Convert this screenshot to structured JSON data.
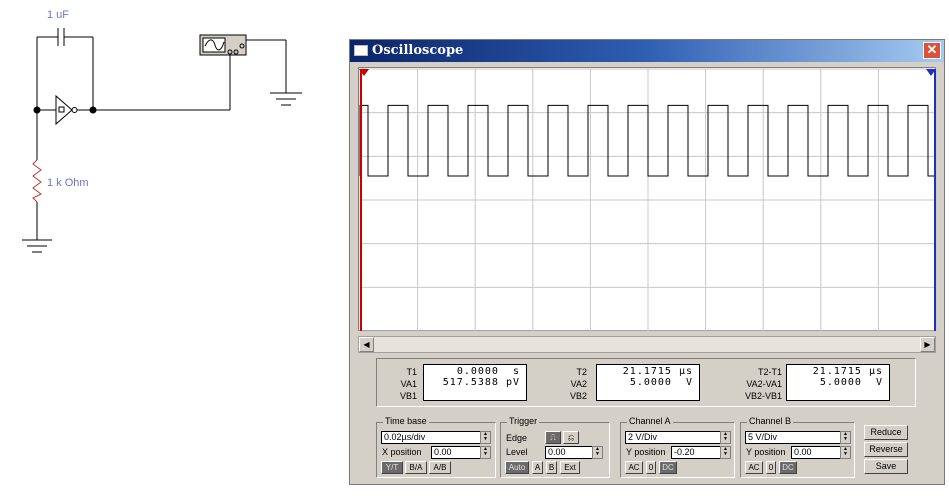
{
  "schematic": {
    "capacitor_label": "1 uF",
    "resistor_label": "1 k Ohm"
  },
  "window": {
    "title": "Oscilloscope",
    "close_glyph": "✕"
  },
  "readouts": {
    "t1": {
      "label": "T1",
      "value": "0.0000  s"
    },
    "va1": {
      "label": "VA1",
      "value": "517.5388 pV"
    },
    "vb1": {
      "label": "VB1",
      "value": ""
    },
    "t2": {
      "label": "T2",
      "value": "21.1715 µs"
    },
    "va2": {
      "label": "VA2",
      "value": "5.0000  V"
    },
    "vb2": {
      "label": "VB2",
      "value": ""
    },
    "dt": {
      "label": "T2-T1",
      "value": "21.1715 µs"
    },
    "dva": {
      "label": "VA2-VA1",
      "value": "5.0000  V"
    },
    "dvb": {
      "label": "VB2-VB1",
      "value": ""
    }
  },
  "timebase": {
    "title": "Time base",
    "scale": "0.02µs/div",
    "xpos_label": "X position",
    "xpos": "0.00",
    "modes": [
      "Y/T",
      "B/A",
      "A/B"
    ]
  },
  "trigger": {
    "title": "Trigger",
    "edge_label": "Edge",
    "level_label": "Level",
    "level": "0.00",
    "buttons": [
      "Auto",
      "A",
      "B",
      "Ext"
    ]
  },
  "channel_a": {
    "title": "Channel A",
    "scale": "2 V/Div",
    "ypos_label": "Y position",
    "ypos": "-0.20",
    "coupling": [
      "AC",
      "0",
      "DC"
    ]
  },
  "channel_b": {
    "title": "Channel B",
    "scale": "5 V/Div",
    "ypos_label": "Y position",
    "ypos": "0.00",
    "coupling": [
      "AC",
      "0",
      "DC"
    ]
  },
  "side_buttons": {
    "reduce": "Reduce",
    "reverse": "Reverse",
    "save": "Save"
  },
  "trace": {
    "periods": 14.4,
    "high_fraction": 0.5,
    "level_high_div": 2.45,
    "level_low_div": 0
  },
  "colors": {
    "trace": "#000000",
    "cursor1": "#cc0000",
    "cursor2": "#1f2fbf",
    "label": "#6b74c9",
    "resistor": "#c0392b"
  }
}
